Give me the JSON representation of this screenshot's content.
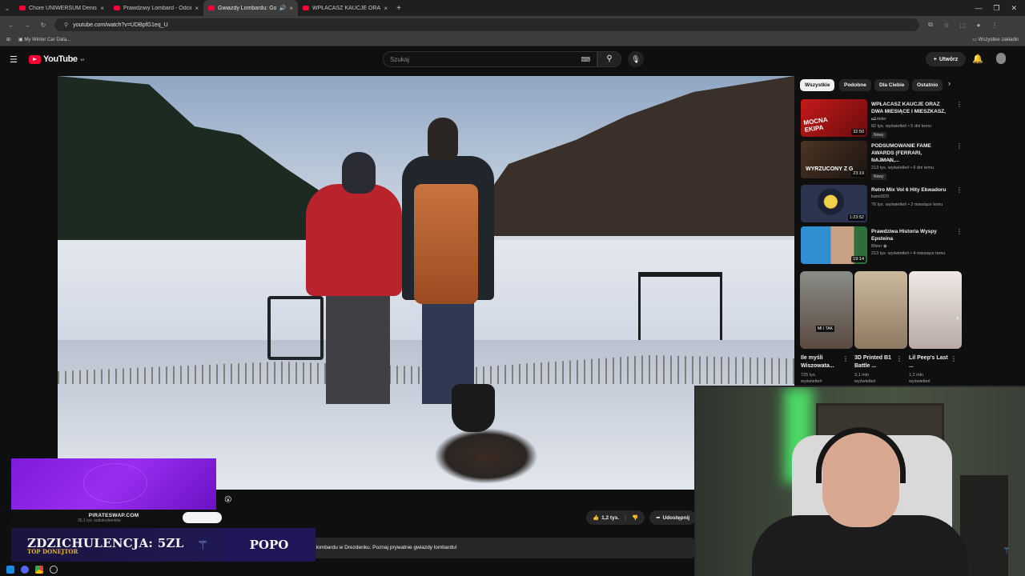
{
  "browser": {
    "tabs": [
      {
        "title": "Chore UNIWERSUM Denisa Zał"
      },
      {
        "title": "Prawdziwy Lombard - Odcinek"
      },
      {
        "title": "Gwiazdy Lombardu: Gotuje"
      },
      {
        "title": "WPŁACASZ KAUCJE ORAZ DWA"
      }
    ],
    "url": "youtube.com/watch?v=UDBpfG1eq_U",
    "bookmark": "My Winter Car Data...",
    "all_bookmarks": "Wszystkie zakładki"
  },
  "youtube": {
    "logo": "YouTube",
    "logo_sup": "NT",
    "search_placeholder": "Szukaj",
    "create_label": "Utwórz"
  },
  "chips": [
    "Wszystkie",
    "Podobne",
    "Dla Ciebie",
    "Ostatnio"
  ],
  "recommendations": [
    {
      "title": "WPŁACASZ KAUCJE ORAZ DWA MIESIĄCE I MIESZKASZ, ...",
      "channel": "eXmiter",
      "meta": "82 tys. wyświetleń • 5 dni temu",
      "badge": "Nowy",
      "duration": "32:50",
      "thumb_color": "#b01515"
    },
    {
      "title": "PODSUMOWANIE FAME AWARDS (FERRARI, NAJMAN,...",
      "channel": "ebe ebe",
      "meta": "213 tys. wyświetleń • 6 dni temu",
      "badge": "Nowy",
      "duration": "23:19",
      "thumb_color": "#3a2a20"
    },
    {
      "title": "Retro Mix Vol 6 Hity Ekwadoru",
      "channel": "kamil320",
      "meta": "76 tys. wyświetleń • 2 miesiące temu",
      "badge": "",
      "duration": "1:23:52",
      "thumb_color": "#1c2233"
    },
    {
      "title": "Prawdziwa Historia Wyspy Epsteina",
      "channel": "Mixer",
      "meta": "213 tys. wyświetleń • 4 miesiące temu",
      "badge": "",
      "duration": "19:14",
      "thumb_color": "#2e6d3c"
    }
  ],
  "shorts": [
    {
      "title": "Ile myśli Wiszowata...",
      "views": "725 tys.",
      "views_label": "wyświetleń",
      "thumb_color": "#5a4a40"
    },
    {
      "title": "3D Printed B1 Battle ...",
      "views": "3,1 mln",
      "views_label": "wyświetleń",
      "thumb_color": "#b29a7c"
    },
    {
      "title": "Lil Peep's Last ...",
      "views": "1,2 mln",
      "views_label": "wyświetleń",
      "thumb_color": "#d8d0cc"
    }
  ],
  "actions": {
    "likes": "1,2 tys.",
    "share": "Udostępnij"
  },
  "description": "ku zobaczysz, co kryje się za kulisami słynnego lombardu w Drezdenku. Poznaj prywatnie gwiazdy lombardu!",
  "overlay": {
    "sponsor": "PIRATESWAP.COM",
    "subs": "35,1 tys. subskrybentów",
    "donor_line": "ZDZICHULENCJA: 5ZL",
    "donor_label": "TOP DONEJTOR",
    "right_name": "POPO",
    "emoji": "😮"
  }
}
